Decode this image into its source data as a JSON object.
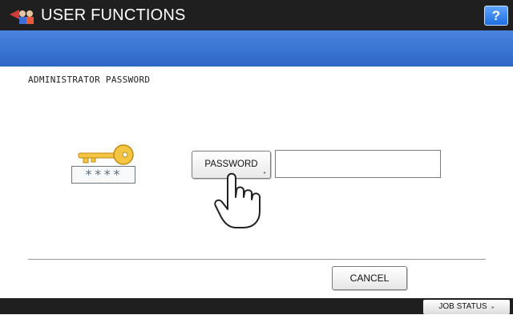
{
  "header": {
    "title": "USER FUNCTIONS",
    "help_label": "?",
    "icon": "user-functions-icon"
  },
  "main": {
    "section_label": "ADMINISTRATOR PASSWORD",
    "key_stars": "****",
    "password_button_label": "PASSWORD",
    "password_field_value": "",
    "cancel_label": "CANCEL"
  },
  "footer": {
    "job_status_label": "JOB STATUS",
    "arrow_glyph": "▸"
  },
  "colors": {
    "title_bar": "#1f1f1f",
    "blue_band": "#3a75d4",
    "help_button": "#2f7bf0",
    "key_gold": "#f4c542"
  },
  "icons": [
    "user-functions-icon",
    "key-icon",
    "hand-pointer-icon",
    "arrow-right-icon"
  ]
}
